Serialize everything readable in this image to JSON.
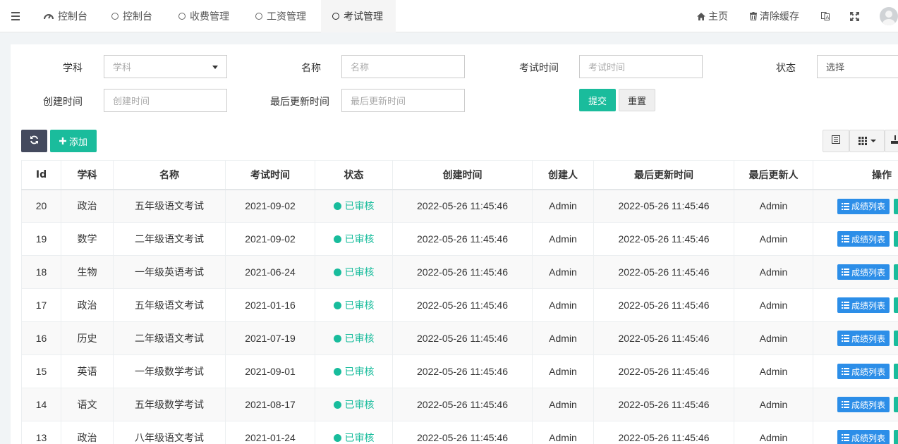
{
  "nav": {
    "tabs": [
      {
        "label": "控制台",
        "icon": "dashboard-icon"
      },
      {
        "label": "控制台",
        "icon": "circle-icon"
      },
      {
        "label": "收费管理",
        "icon": "circle-icon"
      },
      {
        "label": "工资管理",
        "icon": "circle-icon"
      },
      {
        "label": "考试管理",
        "icon": "circle-icon"
      }
    ],
    "home_label": "主页",
    "clear_cache_label": "清除缓存"
  },
  "filters": {
    "subject_label": "学科",
    "subject_placeholder": "学科",
    "name_label": "名称",
    "name_placeholder": "名称",
    "exam_time_label": "考试时间",
    "exam_time_placeholder": "考试时间",
    "status_label": "状态",
    "status_value": "选择",
    "create_time_label": "创建时间",
    "create_time_placeholder": "创建时间",
    "update_time_label": "最后更新时间",
    "update_time_placeholder": "最后更新时间",
    "submit_label": "提交",
    "reset_label": "重置"
  },
  "toolbar": {
    "add_label": "添加"
  },
  "table": {
    "columns": [
      "Id",
      "学科",
      "名称",
      "考试时间",
      "状态",
      "创建时间",
      "创建人",
      "最后更新时间",
      "最后更新人",
      "操作"
    ],
    "action_label": "成绩列表",
    "rows": [
      {
        "id": "20",
        "subject": "政治",
        "name": "五年级语文考试",
        "exam_time": "2021-09-02",
        "status": "已审核",
        "created": "2022-05-26 11:45:46",
        "creator": "Admin",
        "updated": "2022-05-26 11:45:46",
        "updater": "Admin"
      },
      {
        "id": "19",
        "subject": "数学",
        "name": "二年级语文考试",
        "exam_time": "2021-09-02",
        "status": "已审核",
        "created": "2022-05-26 11:45:46",
        "creator": "Admin",
        "updated": "2022-05-26 11:45:46",
        "updater": "Admin"
      },
      {
        "id": "18",
        "subject": "生物",
        "name": "一年级英语考试",
        "exam_time": "2021-06-24",
        "status": "已审核",
        "created": "2022-05-26 11:45:46",
        "creator": "Admin",
        "updated": "2022-05-26 11:45:46",
        "updater": "Admin"
      },
      {
        "id": "17",
        "subject": "政治",
        "name": "五年级语文考试",
        "exam_time": "2021-01-16",
        "status": "已审核",
        "created": "2022-05-26 11:45:46",
        "creator": "Admin",
        "updated": "2022-05-26 11:45:46",
        "updater": "Admin"
      },
      {
        "id": "16",
        "subject": "历史",
        "name": "二年级语文考试",
        "exam_time": "2021-07-19",
        "status": "已审核",
        "created": "2022-05-26 11:45:46",
        "creator": "Admin",
        "updated": "2022-05-26 11:45:46",
        "updater": "Admin"
      },
      {
        "id": "15",
        "subject": "英语",
        "name": "一年级数学考试",
        "exam_time": "2021-09-01",
        "status": "已审核",
        "created": "2022-05-26 11:45:46",
        "creator": "Admin",
        "updated": "2022-05-26 11:45:46",
        "updater": "Admin"
      },
      {
        "id": "14",
        "subject": "语文",
        "name": "五年级数学考试",
        "exam_time": "2021-08-17",
        "status": "已审核",
        "created": "2022-05-26 11:45:46",
        "creator": "Admin",
        "updated": "2022-05-26 11:45:46",
        "updater": "Admin"
      },
      {
        "id": "13",
        "subject": "政治",
        "name": "八年级语文考试",
        "exam_time": "2021-01-24",
        "status": "已审核",
        "created": "2022-05-26 11:45:46",
        "creator": "Admin",
        "updated": "2022-05-26 11:45:46",
        "updater": "Admin"
      }
    ]
  },
  "colors": {
    "accent": "#1abc9c",
    "primary": "#2c8ee8",
    "dark": "#444a5e"
  }
}
